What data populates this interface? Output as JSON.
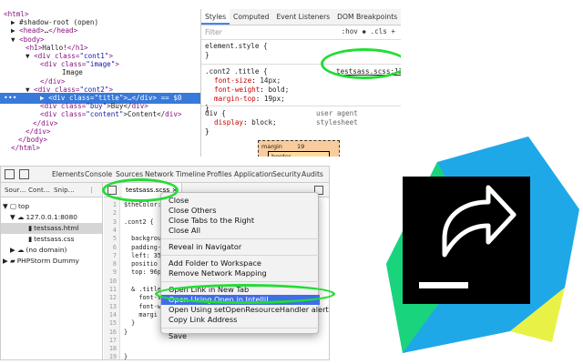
{
  "elements_tree": [
    {
      "indent": 4,
      "tag_open": "<html>",
      "tag_close": ""
    },
    {
      "indent": 12,
      "tag_open": "",
      "text": "#shadow-root (open)",
      "caret": "▶"
    },
    {
      "indent": 12,
      "tag_open": "<head>",
      "text": "…",
      "tag_close": "</head>",
      "caret": "▶"
    },
    {
      "indent": 12,
      "tag_open": "<body>",
      "caret": "▼"
    },
    {
      "indent": 28,
      "tag_open": "<h1>",
      "text": "Hallo!",
      "tag_close": "</h1>"
    },
    {
      "indent": 28,
      "tag_open": "<div class=",
      "attr_val": "\"cont1\"",
      "tag_close": ">",
      "caret": "▼"
    },
    {
      "indent": 44,
      "tag_open": "<div class=",
      "attr_val": "\"image\"",
      "tag_close": ">"
    },
    {
      "indent": 68,
      "text": "Image"
    },
    {
      "indent": 44,
      "tag_open": "</div>"
    },
    {
      "indent": 28,
      "tag_open": "<div class=",
      "attr_val": "\"cont2\"",
      "tag_close": ">",
      "caret": "▼"
    },
    {
      "indent": 44,
      "tag_open": "<div class=",
      "attr_val": "\"title\"",
      "tag_close": ">…</div> == $0",
      "caret": "▶",
      "selected": true
    },
    {
      "indent": 44,
      "tag_open": "<div class=",
      "attr_val": "\"buy\"",
      "text": ">Buy</",
      "tag_close": "div>"
    },
    {
      "indent": 44,
      "tag_open": "<div class=",
      "attr_val": "\"content\"",
      "text": ">Content</",
      "tag_close": "div>"
    },
    {
      "indent": 36,
      "tag_open": "</div>"
    },
    {
      "indent": 28,
      "tag_open": "</div>"
    },
    {
      "indent": 20,
      "tag_open": "</body>"
    },
    {
      "indent": 12,
      "tag_open": "</html>"
    }
  ],
  "selected_dots": "•••",
  "styles": {
    "tabs": [
      "Styles",
      "Computed",
      "Event Listeners",
      "DOM Breakpoints",
      "»"
    ],
    "filter_placeholder": "Filter",
    "filter_tools": ":hov  ◆  .cls  +",
    "element_style": "element.style {",
    "element_style_close": "}",
    "rule_selector": ".cont2 .title {",
    "rule_source": "testsass.scss:12",
    "rule_props": [
      {
        "name": "font-size",
        "value": "14px;"
      },
      {
        "name": "font-weight",
        "value": "bold;"
      },
      {
        "name": "margin-top",
        "value": "19px;"
      }
    ],
    "rule_close": "}",
    "ua_selector": "div {",
    "ua_label": "user agent stylesheet",
    "ua_prop": {
      "name": "display",
      "value": "block;"
    },
    "ua_close": "}",
    "box_model": {
      "label": "margin",
      "value": "19",
      "inner_label": "border",
      "inner_value": "–"
    }
  },
  "sources": {
    "top_tabs": [
      "Elements",
      "Console",
      "Sources",
      "Network",
      "Timeline",
      "Profiles",
      "Application",
      "Security",
      "Audits"
    ],
    "nav_tabs": [
      "Sour…",
      "Cont…",
      "Snip…",
      "⋮"
    ],
    "nav_items": [
      {
        "glyph": "▼ ▢",
        "label": "top",
        "indent": 2
      },
      {
        "glyph": "▼ ☁",
        "label": "127.0.0.1:8080",
        "indent": 10
      },
      {
        "glyph": "▮",
        "label": "testsass.html",
        "indent": 30,
        "selected": true
      },
      {
        "glyph": "▮",
        "label": "testsass.css",
        "indent": 30
      },
      {
        "glyph": "▶ ☁",
        "label": "(no domain)",
        "indent": 10
      },
      {
        "glyph": "▶ ▰",
        "label": "PHPStorm Dummy",
        "indent": 2
      }
    ],
    "editor_tab": "testsass.scss ×",
    "line_numbers": [
      "1",
      "2",
      "3",
      "4",
      "5",
      "6",
      "7",
      "8",
      "9",
      "10",
      "11",
      "12",
      "13",
      "14",
      "15",
      "16",
      "17",
      "18",
      "19"
    ],
    "code_lines": [
      "$theColor: ",
      "",
      ".cont2 {",
      "",
      "  backgrou",
      "  padding-",
      "  left: 35",
      "  positio",
      "  top: 96p",
      "",
      "  & .title",
      "    font-s",
      "    font-w",
      "    margi",
      "  }",
      "}",
      "",
      "",
      "}"
    ]
  },
  "context_menu": {
    "items": [
      {
        "label": "Close",
        "sep_after": false
      },
      {
        "label": "Close Others",
        "sep_after": false
      },
      {
        "label": "Close Tabs to the Right",
        "sep_after": false
      },
      {
        "label": "Close All",
        "sep_after": true
      },
      {
        "label": "Reveal in Navigator",
        "sep_after": true
      },
      {
        "label": "Add Folder to Workspace",
        "sep_after": false
      },
      {
        "label": "Remove Network Mapping",
        "sep_after": true
      },
      {
        "label": "Open Link in New Tab",
        "sep_after": false
      },
      {
        "label": "Open Using Open in IntelliJ",
        "highlighted": true,
        "sep_after": false
      },
      {
        "label": "Open Using setOpenResourceHandler alert",
        "sep_after": false
      },
      {
        "label": "Copy Link Address",
        "sep_after": true
      },
      {
        "label": "Save",
        "sep_after": false
      }
    ]
  },
  "colors": {
    "selection_blue": "#3879d9",
    "menu_highlight": "#3f6ee8",
    "oval_green": "#22dd33",
    "logo_blue": "#1fa8e8",
    "logo_green": "#19d47c",
    "logo_yellow": "#e8f246",
    "logo_dark": "#000000"
  },
  "logo": {
    "icon": "share-arrow-icon"
  }
}
